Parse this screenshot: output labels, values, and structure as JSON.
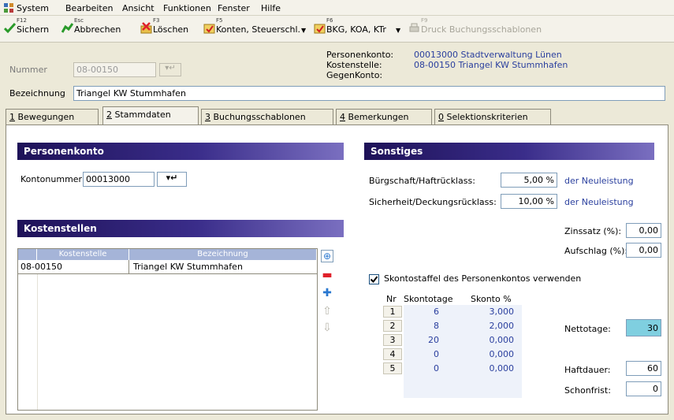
{
  "menu": [
    "System",
    "Bearbeiten",
    "Ansicht",
    "Funktionen",
    "Fenster",
    "Hilfe"
  ],
  "toolbar": {
    "save": {
      "key": "F12",
      "label": "Sichern"
    },
    "cancel": {
      "key": "Esc",
      "label": "Abbrechen"
    },
    "delete": {
      "key": "F3",
      "label": "Löschen"
    },
    "accounts": {
      "key": "F5",
      "label": "Konten, Steuerschl."
    },
    "bkg": {
      "key": "F6",
      "label": "BKG, KOA, KTr"
    },
    "print": {
      "key": "F9",
      "label": "Druck Buchungsschablonen"
    }
  },
  "header": {
    "nummer_label": "Nummer",
    "nummer_value": "08-00150",
    "personenkonto_label": "Personenkonto:",
    "personenkonto_value": "00013000  Stadtverwaltung Lünen",
    "kostenstelle_label": "Kostenstelle:",
    "kostenstelle_value": "08-00150  Triangel KW Stummhafen",
    "gegenkonto_label": "GegenKonto:",
    "bezeichnung_label": "Bezeichnung",
    "bezeichnung_value": "Triangel KW Stummhafen"
  },
  "tabs": [
    {
      "num": "1",
      "label": " Bewegungen"
    },
    {
      "num": "2",
      "label": " Stammdaten"
    },
    {
      "num": "3",
      "label": " Buchungsschablonen"
    },
    {
      "num": "4",
      "label": " Bemerkungen"
    },
    {
      "num": "0",
      "label": " Selektionskriterien"
    }
  ],
  "personenkonto": {
    "title": "Personenkonto",
    "kontonummer_label": "Kontonummer:",
    "kontonummer_value": "00013000"
  },
  "kostenstellen": {
    "title": "Kostenstellen",
    "columns": [
      "Kostenstelle",
      "Bezeichnung"
    ],
    "rows": [
      {
        "kostenstelle": "08-00150",
        "bezeichnung": "Triangel KW Stummhafen"
      }
    ]
  },
  "sonstiges": {
    "title": "Sonstiges",
    "buergschaft_label": "Bürgschaft/Haftrücklass:",
    "buergschaft_value": "5,00 %",
    "buergschaft_suffix": "der Neuleistung",
    "sicherheit_label": "Sicherheit/Deckungsrücklass:",
    "sicherheit_value": "10,00 %",
    "sicherheit_suffix": "der Neuleistung",
    "zinssatz_label": "Zinssatz (%):",
    "zinssatz_value": "0,00",
    "aufschlag_label": "Aufschlag (%):",
    "aufschlag_value": "0,00",
    "skonto_checkbox_label": "Skontostaffel des Personenkontos verwenden",
    "skonto_columns": [
      "Nr",
      "Skontotage",
      "Skonto %"
    ],
    "skonto_rows": [
      {
        "nr": "1",
        "tage": "6",
        "prozent": "3,000"
      },
      {
        "nr": "2",
        "tage": "8",
        "prozent": "2,000"
      },
      {
        "nr": "3",
        "tage": "20",
        "prozent": "0,000"
      },
      {
        "nr": "4",
        "tage": "0",
        "prozent": "0,000"
      },
      {
        "nr": "5",
        "tage": "0",
        "prozent": "0,000"
      }
    ],
    "nettotage_label": "Nettotage:",
    "nettotage_value": "30",
    "haftdauer_label": "Haftdauer:",
    "haftdauer_value": "60",
    "schonfrist_label": "Schonfrist:",
    "schonfrist_value": "0"
  },
  "colors": {
    "section_dark": "#1e1258",
    "highlight_field": "#7fcfe0",
    "link_blue": "#2a3f9e",
    "delete_red": "#e0202a",
    "add_blue": "#2a78d0"
  }
}
